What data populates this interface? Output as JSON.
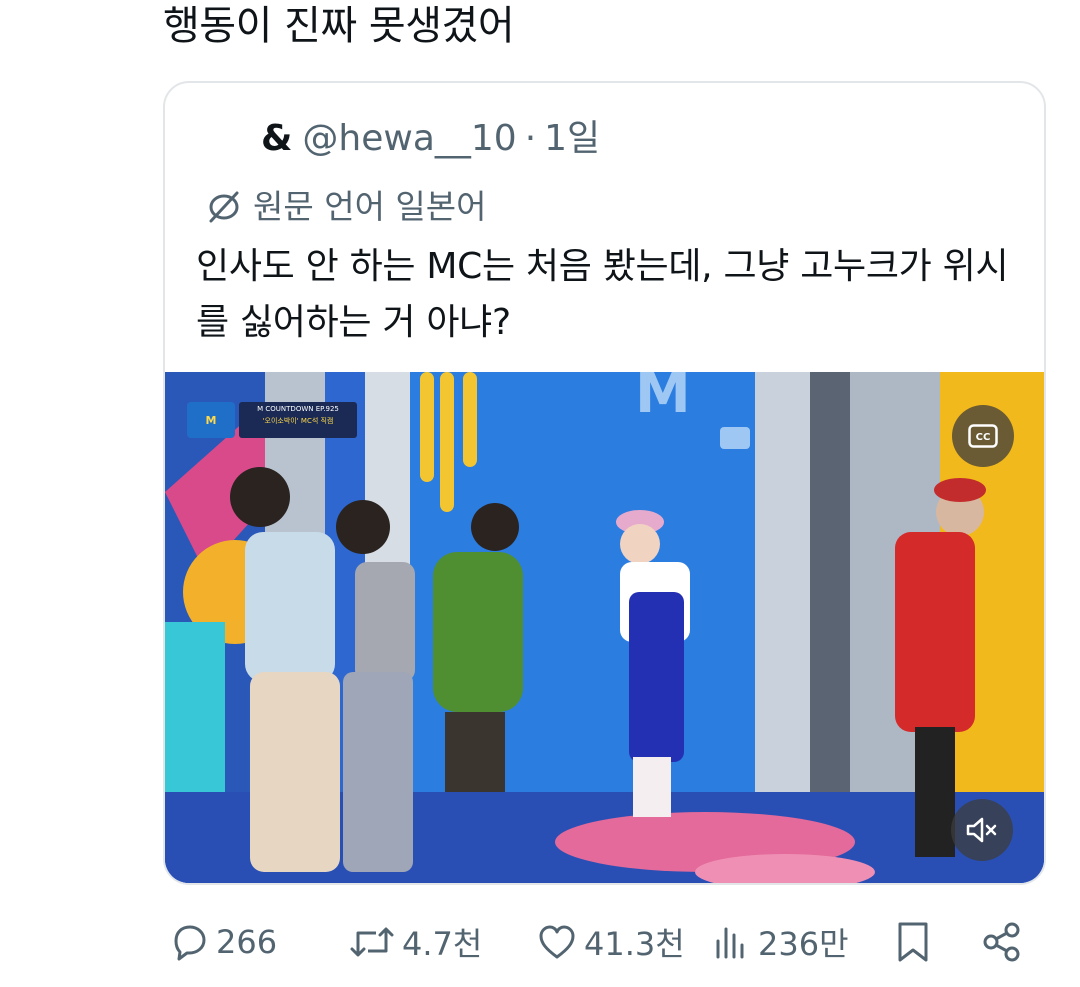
{
  "tweet": {
    "text": "행동이 진짜 못생겼어"
  },
  "quote": {
    "author_prefix": "&",
    "handle": "@hewa__10",
    "separator": "·",
    "time": "1일",
    "translate_label": "원문 언어 일본어",
    "body": "인사도 안 하는 MC는 처음 봤는데, 그냥 고누크가 위시를 싫어하는 거 아냐?",
    "media": {
      "badge_line1": "M COUNTDOWN EP.925",
      "badge_line2": "'오이소박이' MC석 직캠",
      "cc_icon": "closed-captions-icon",
      "mute_icon": "muted-speaker-icon"
    }
  },
  "actions": {
    "replies": "266",
    "reposts": "4.7천",
    "likes": "41.3천",
    "views": "236만"
  },
  "colors": {
    "text": "#0f1419",
    "secondary": "#536471",
    "border": "#e3e6e8"
  }
}
